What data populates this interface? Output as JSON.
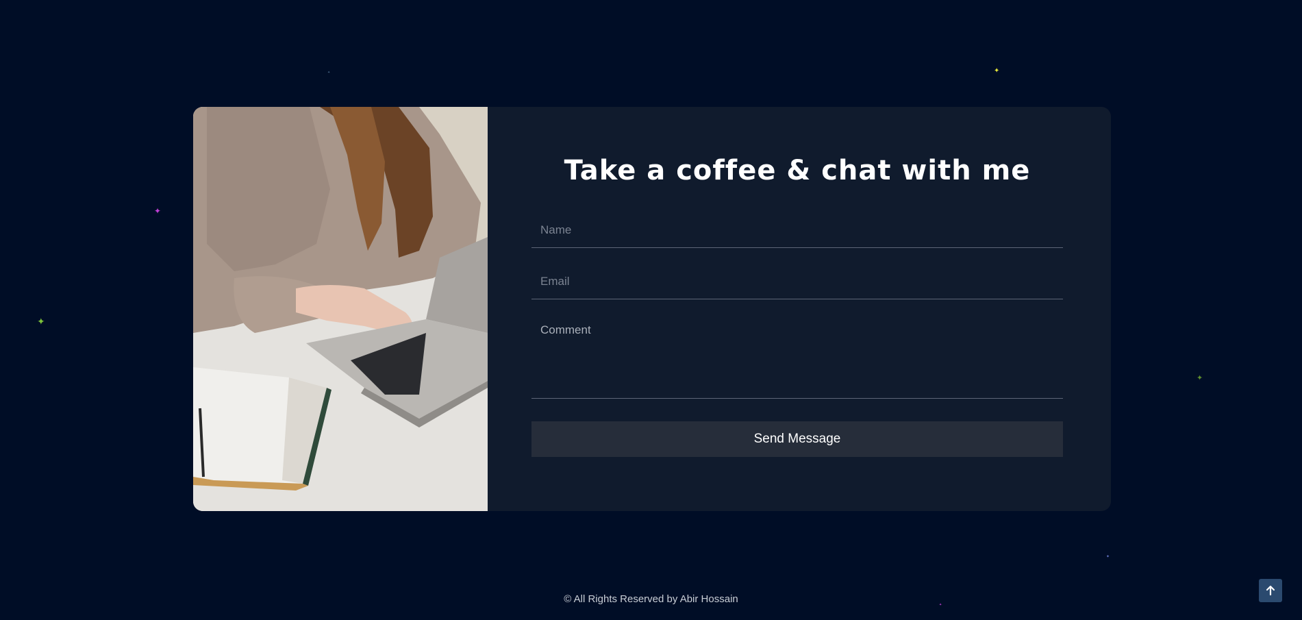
{
  "contact": {
    "title": "Take a coffee & chat with me",
    "name_placeholder": "Name",
    "email_placeholder": "Email",
    "comment_placeholder": "Comment",
    "send_label": "Send Message"
  },
  "footer": {
    "copyright": "© All Rights Reserved by Abir Hossain"
  },
  "icons": {
    "scroll_top": "arrow-up-icon",
    "sparkle": "sparkle-icon"
  },
  "colors": {
    "page_bg": "#000d26",
    "card_bg": "#101b2d",
    "button_bg": "#262d3a",
    "scroll_top_bg": "#2b4a6f",
    "sparkle_green": "#7cc23b",
    "sparkle_magenta": "#c13fd6",
    "sparkle_yellow": "#e5e83a"
  }
}
